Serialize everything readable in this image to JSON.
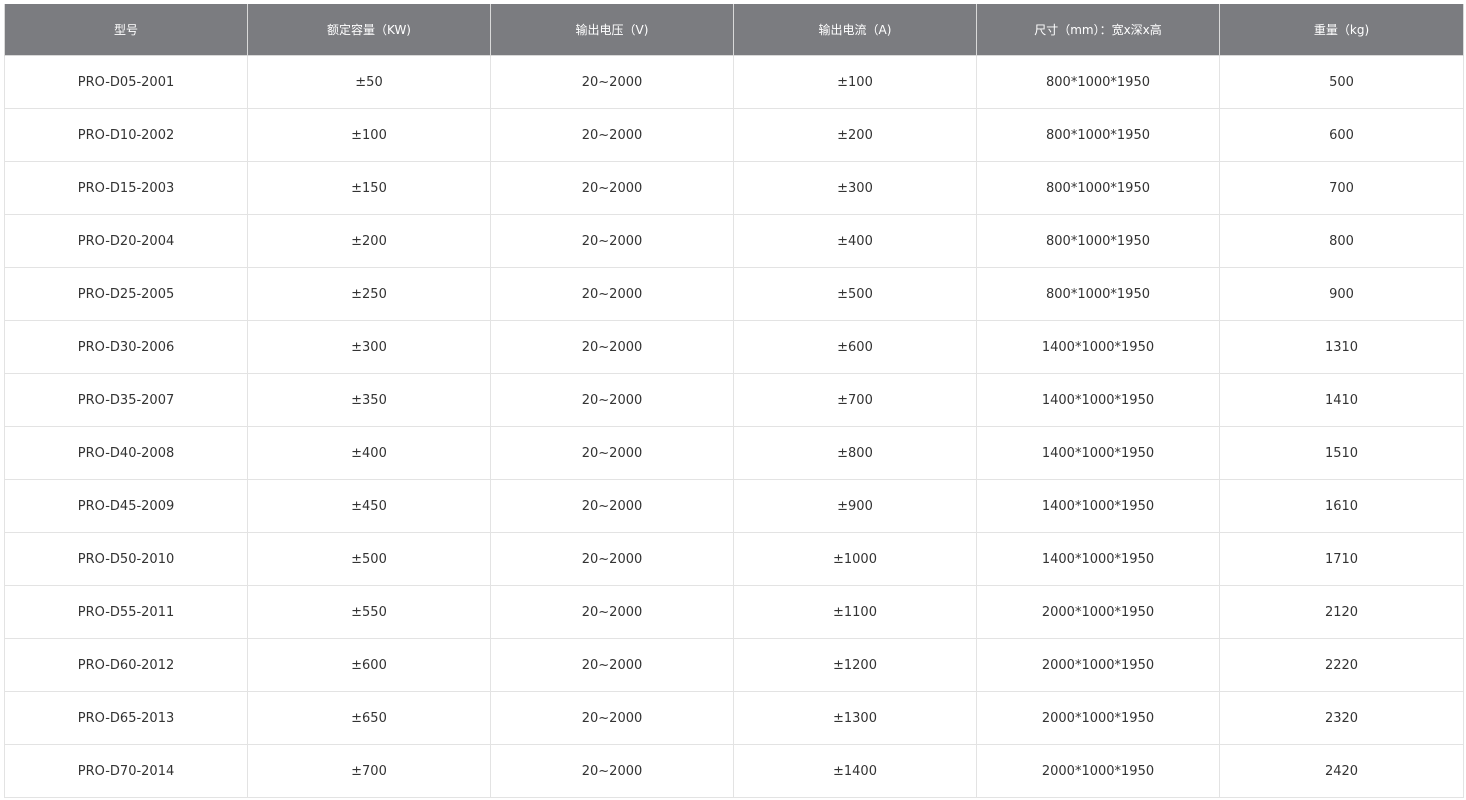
{
  "table": {
    "headers": [
      "型号",
      "额定容量（KW)",
      "输出电压（V)",
      "输出电流（A)",
      "尺寸（mm）：宽x深x高",
      "重量（kg)"
    ],
    "rows": [
      [
        "PRO-D05-2001",
        "±50",
        "20~2000",
        "±100",
        "800*1000*1950",
        "500"
      ],
      [
        "PRO-D10-2002",
        "±100",
        "20~2000",
        "±200",
        "800*1000*1950",
        "600"
      ],
      [
        "PRO-D15-2003",
        "±150",
        "20~2000",
        "±300",
        "800*1000*1950",
        "700"
      ],
      [
        "PRO-D20-2004",
        "±200",
        "20~2000",
        "±400",
        "800*1000*1950",
        "800"
      ],
      [
        "PRO-D25-2005",
        "±250",
        "20~2000",
        "±500",
        "800*1000*1950",
        "900"
      ],
      [
        "PRO-D30-2006",
        "±300",
        "20~2000",
        "±600",
        "1400*1000*1950",
        "1310"
      ],
      [
        "PRO-D35-2007",
        "±350",
        "20~2000",
        "±700",
        "1400*1000*1950",
        "1410"
      ],
      [
        "PRO-D40-2008",
        "±400",
        "20~2000",
        "±800",
        "1400*1000*1950",
        "1510"
      ],
      [
        "PRO-D45-2009",
        "±450",
        "20~2000",
        "±900",
        "1400*1000*1950",
        "1610"
      ],
      [
        "PRO-D50-2010",
        "±500",
        "20~2000",
        "±1000",
        "1400*1000*1950",
        "1710"
      ],
      [
        "PRO-D55-2011",
        "±550",
        "20~2000",
        "±1100",
        "2000*1000*1950",
        "2120"
      ],
      [
        "PRO-D60-2012",
        "±600",
        "20~2000",
        "±1200",
        "2000*1000*1950",
        "2220"
      ],
      [
        "PRO-D65-2013",
        "±650",
        "20~2000",
        "±1300",
        "2000*1000*1950",
        "2320"
      ],
      [
        "PRO-D70-2014",
        "±700",
        "20~2000",
        "±1400",
        "2000*1000*1950",
        "2420"
      ]
    ]
  },
  "colors": {
    "header_background": "#7b7c80",
    "header_text": "#ffffff",
    "cell_text": "#333333",
    "grid_line": "#e3e3e3"
  }
}
